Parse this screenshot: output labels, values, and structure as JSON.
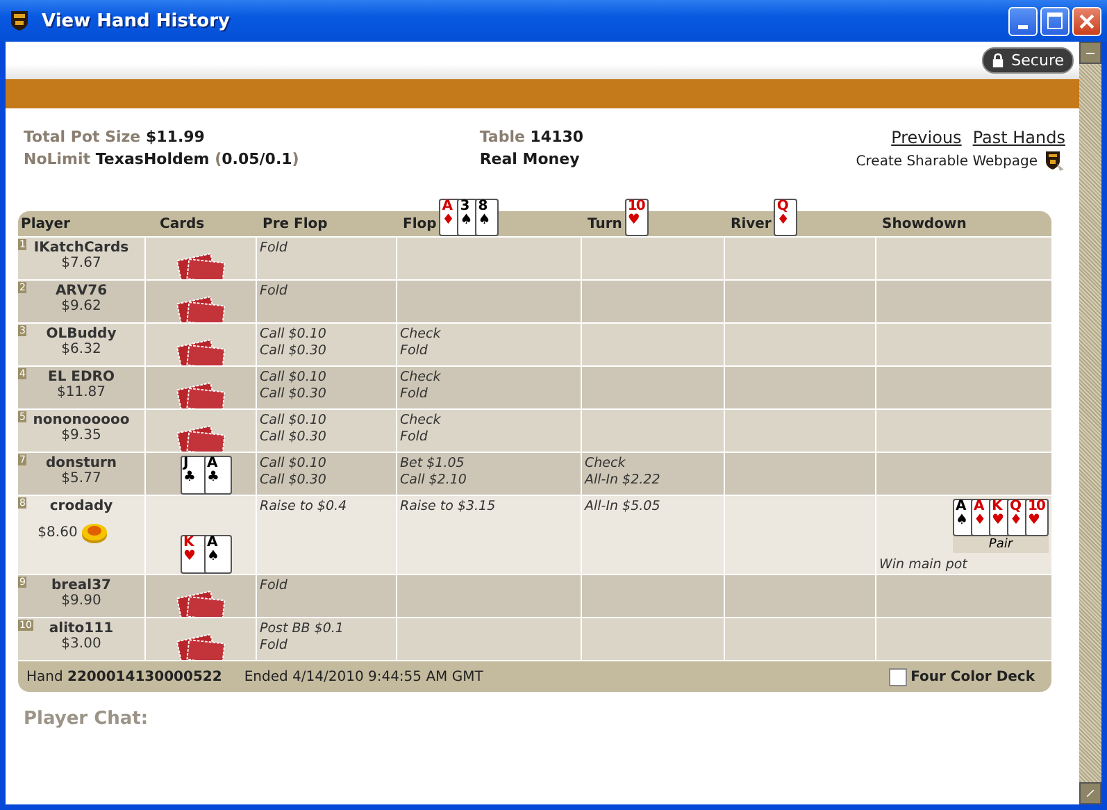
{
  "window": {
    "title": "View Hand History"
  },
  "secure_badge": "Secure",
  "summary": {
    "pot": "Total Pot Size **$11.99**",
    "game": "NoLimit **TexasHoldem** (**0.05/0.1**)",
    "table": "Table **14130**",
    "money": "Real Money"
  },
  "links": [
    {
      "label": "Previous"
    },
    {
      "label": "Past Hands"
    }
  ],
  "share": "Create Sharable Webpage",
  "columns": [
    {
      "label": "Player"
    },
    {
      "label": "Cards"
    },
    {
      "label": "Pre Flop"
    },
    {
      "label": "Flop",
      "cards": [
        {
          "rank": "A",
          "suit": "♦",
          "color": "#d40000"
        },
        {
          "rank": "3",
          "suit": "♠",
          "color": "#000000"
        },
        {
          "rank": "8",
          "suit": "♠",
          "color": "#000000"
        }
      ]
    },
    {
      "label": "Turn",
      "cards": [
        {
          "rank": "10",
          "suit": "♥",
          "color": "#d40000"
        }
      ]
    },
    {
      "label": "River",
      "cards": [
        {
          "rank": "Q",
          "suit": "♦",
          "color": "#d40000"
        }
      ]
    },
    {
      "label": "Showdown"
    }
  ],
  "rows": [
    {
      "seat": "1",
      "name": "IKatchCards",
      "stack": "$7.67",
      "dealer": false,
      "highlight": false,
      "mucked": true,
      "preflop": [
        "Fold"
      ]
    },
    {
      "seat": "2",
      "name": "ARV76",
      "stack": "$9.62",
      "dealer": false,
      "highlight": false,
      "mucked": true,
      "preflop": [
        "Fold"
      ]
    },
    {
      "seat": "3",
      "name": "OLBuddy",
      "stack": "$6.32",
      "dealer": false,
      "highlight": false,
      "mucked": true,
      "preflop": [
        "Call $0.10",
        "Call $0.30"
      ],
      "flop": [
        "Check",
        "Fold"
      ]
    },
    {
      "seat": "4",
      "name": "EL EDRO",
      "stack": "$11.87",
      "dealer": false,
      "highlight": false,
      "mucked": true,
      "preflop": [
        "Call $0.10",
        "Call $0.30"
      ],
      "flop": [
        "Check",
        "Fold"
      ]
    },
    {
      "seat": "5",
      "name": "nononooooo",
      "stack": "$9.35",
      "dealer": false,
      "highlight": false,
      "mucked": true,
      "preflop": [
        "Call $0.10",
        "Call $0.30"
      ],
      "flop": [
        "Check",
        "Fold"
      ]
    },
    {
      "seat": "7",
      "name": "donsturn",
      "stack": "$5.77",
      "dealer": false,
      "highlight": false,
      "mucked": false,
      "cards": [
        {
          "rank": "J",
          "suit": "♣",
          "color": "#000000"
        },
        {
          "rank": "A",
          "suit": "♣",
          "color": "#000000"
        }
      ],
      "preflop": [
        "Call $0.10",
        "Call $0.30"
      ],
      "flop": [
        "Bet $1.05",
        "Call $2.10"
      ],
      "turn": [
        "Check",
        "All-In $2.22"
      ]
    },
    {
      "seat": "8",
      "name": "crodady",
      "stack": "$8.60",
      "dealer": true,
      "highlight": true,
      "mucked": false,
      "cards": [
        {
          "rank": "K",
          "suit": "♥",
          "color": "#d40000"
        },
        {
          "rank": "A",
          "suit": "♠",
          "color": "#000000"
        }
      ],
      "preflop": [
        "Raise to $0.4"
      ],
      "flop": [
        "Raise to $3.15"
      ],
      "turn": [
        "All-In $5.05"
      ],
      "showdown": {
        "cards": [
          {
            "rank": "A",
            "suit": "♠",
            "color": "#000000"
          },
          {
            "rank": "A",
            "suit": "♦",
            "color": "#d40000"
          },
          {
            "rank": "K",
            "suit": "♥",
            "color": "#d40000"
          },
          {
            "rank": "Q",
            "suit": "♦",
            "color": "#d40000"
          },
          {
            "rank": "10",
            "suit": "♥",
            "color": "#d40000"
          }
        ],
        "hand": "Pair",
        "result": "Win main pot"
      }
    },
    {
      "seat": "9",
      "name": "breal37",
      "stack": "$9.90",
      "dealer": false,
      "highlight": false,
      "mucked": true,
      "preflop": [
        "Fold"
      ]
    },
    {
      "seat": "10",
      "name": "alito111",
      "stack": "$3.00",
      "dealer": false,
      "highlight": false,
      "mucked": true,
      "preflop": [
        "Post BB $0.1",
        "Fold"
      ]
    }
  ],
  "footer": {
    "hand": "Hand **2200014130000522**",
    "ended": "Ended 4/14/2010 9:44:55 AM GMT",
    "four_color": {
      "label": "Four Color Deck",
      "checked": false
    }
  },
  "chat_title": "Player Chat:"
}
